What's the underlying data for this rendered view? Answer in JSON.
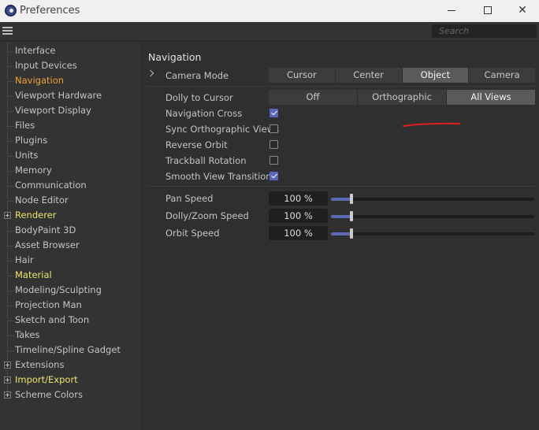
{
  "window": {
    "title": "Preferences",
    "minimize_icon": "minimize-icon",
    "maximize_icon": "maximize-icon",
    "close_icon": "close-icon",
    "close_glyph": "✕"
  },
  "search": {
    "placeholder": "Search"
  },
  "sidebar": {
    "items": [
      {
        "label": "Interface",
        "expandable": false,
        "style": "normal"
      },
      {
        "label": "Input Devices",
        "expandable": false,
        "style": "normal"
      },
      {
        "label": "Navigation",
        "expandable": false,
        "style": "selected"
      },
      {
        "label": "Viewport Hardware",
        "expandable": false,
        "style": "normal"
      },
      {
        "label": "Viewport Display",
        "expandable": false,
        "style": "normal"
      },
      {
        "label": "Files",
        "expandable": false,
        "style": "normal"
      },
      {
        "label": "Plugins",
        "expandable": false,
        "style": "normal"
      },
      {
        "label": "Units",
        "expandable": false,
        "style": "normal"
      },
      {
        "label": "Memory",
        "expandable": false,
        "style": "normal"
      },
      {
        "label": "Communication",
        "expandable": false,
        "style": "normal"
      },
      {
        "label": "Node Editor",
        "expandable": false,
        "style": "normal"
      },
      {
        "label": "Renderer",
        "expandable": true,
        "style": "highlight"
      },
      {
        "label": "BodyPaint 3D",
        "expandable": false,
        "style": "normal"
      },
      {
        "label": "Asset Browser",
        "expandable": false,
        "style": "normal"
      },
      {
        "label": "Hair",
        "expandable": false,
        "style": "normal"
      },
      {
        "label": "Material",
        "expandable": false,
        "style": "highlight"
      },
      {
        "label": "Modeling/Sculpting",
        "expandable": false,
        "style": "normal"
      },
      {
        "label": "Projection Man",
        "expandable": false,
        "style": "normal"
      },
      {
        "label": "Sketch and Toon",
        "expandable": false,
        "style": "normal"
      },
      {
        "label": "Takes",
        "expandable": false,
        "style": "normal"
      },
      {
        "label": "Timeline/Spline Gadget",
        "expandable": false,
        "style": "normal"
      },
      {
        "label": "Extensions",
        "expandable": true,
        "style": "normal"
      },
      {
        "label": "Import/Export",
        "expandable": true,
        "style": "highlight"
      },
      {
        "label": "Scheme Colors",
        "expandable": true,
        "style": "normal"
      }
    ]
  },
  "main": {
    "section_title": "Navigation",
    "camera_mode": {
      "label": "Camera Mode",
      "options": [
        "Cursor",
        "Center",
        "Object",
        "Camera"
      ],
      "selected": "Object"
    },
    "dolly_to_cursor": {
      "label": "Dolly to Cursor",
      "options": [
        "Off",
        "Orthographic",
        "All Views"
      ],
      "selected": "All Views"
    },
    "checkboxes": [
      {
        "label": "Navigation Cross",
        "checked": true
      },
      {
        "label": "Sync Orthographic Views",
        "checked": false
      },
      {
        "label": "Reverse Orbit",
        "checked": false
      },
      {
        "label": "Trackball Rotation",
        "checked": false
      },
      {
        "label": "Smooth View Transition",
        "checked": true
      }
    ],
    "speeds": [
      {
        "label": "Pan Speed",
        "value": "100 %",
        "level": 0.1
      },
      {
        "label": "Dolly/Zoom Speed",
        "value": "100 %",
        "level": 0.1
      },
      {
        "label": "Orbit Speed",
        "value": "100 %",
        "level": 0.1
      }
    ]
  },
  "colors": {
    "selected_item": "#f0a236",
    "highlight_item": "#ece36b",
    "accent": "#5b66b8",
    "annotation": "#d42020"
  }
}
